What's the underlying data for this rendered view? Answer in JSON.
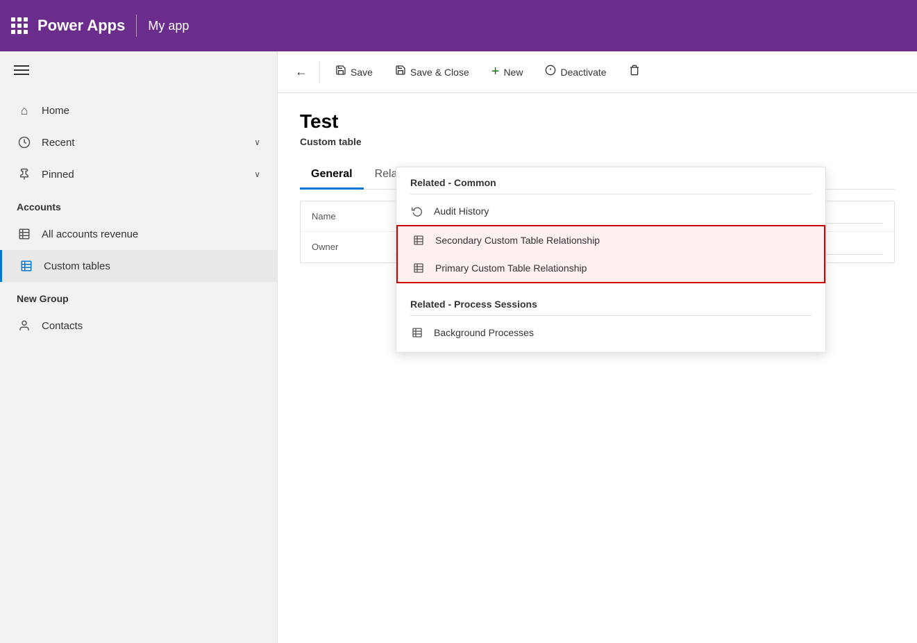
{
  "header": {
    "grid_icon": "apps",
    "brand": "Power Apps",
    "divider": true,
    "app_name": "My app"
  },
  "sidebar": {
    "hamburger_label": "Menu",
    "nav_items": [
      {
        "id": "home",
        "icon": "⌂",
        "label": "Home",
        "chevron": false,
        "active": false
      },
      {
        "id": "recent",
        "icon": "🕐",
        "label": "Recent",
        "chevron": true,
        "active": false
      },
      {
        "id": "pinned",
        "icon": "📌",
        "label": "Pinned",
        "chevron": true,
        "active": false
      }
    ],
    "sections": [
      {
        "header": "Accounts",
        "items": [
          {
            "id": "all-accounts-revenue",
            "icon": "⊞",
            "label": "All accounts revenue",
            "active": false
          },
          {
            "id": "custom-tables",
            "icon": "🗂",
            "label": "Custom tables",
            "active": true
          }
        ]
      },
      {
        "header": "New Group",
        "items": [
          {
            "id": "contacts",
            "icon": "👤",
            "label": "Contacts",
            "active": false
          }
        ]
      }
    ]
  },
  "toolbar": {
    "back_label": "←",
    "save_label": "Save",
    "save_close_label": "Save & Close",
    "new_label": "New",
    "deactivate_label": "Deactivate",
    "delete_icon": "🗑"
  },
  "record": {
    "title": "Test",
    "subtitle": "Custom table"
  },
  "tabs": [
    {
      "id": "general",
      "label": "General",
      "active": true
    },
    {
      "id": "related",
      "label": "Related",
      "active": false
    }
  ],
  "form": {
    "rows": [
      {
        "label": "Name",
        "value": ""
      },
      {
        "label": "Owner",
        "value": ""
      }
    ]
  },
  "dropdown": {
    "sections": [
      {
        "header": "Related - Common",
        "items": [
          {
            "id": "audit-history",
            "icon": "history",
            "label": "Audit History",
            "highlighted": false
          },
          {
            "id": "secondary-custom-table",
            "icon": "table",
            "label": "Secondary Custom Table Relationship",
            "highlighted": true
          },
          {
            "id": "primary-custom-table",
            "icon": "table",
            "label": "Primary Custom Table Relationship",
            "highlighted": true
          }
        ]
      },
      {
        "header": "Related - Process Sessions",
        "items": [
          {
            "id": "background-processes",
            "icon": "table",
            "label": "Background Processes",
            "highlighted": false
          }
        ]
      }
    ]
  }
}
